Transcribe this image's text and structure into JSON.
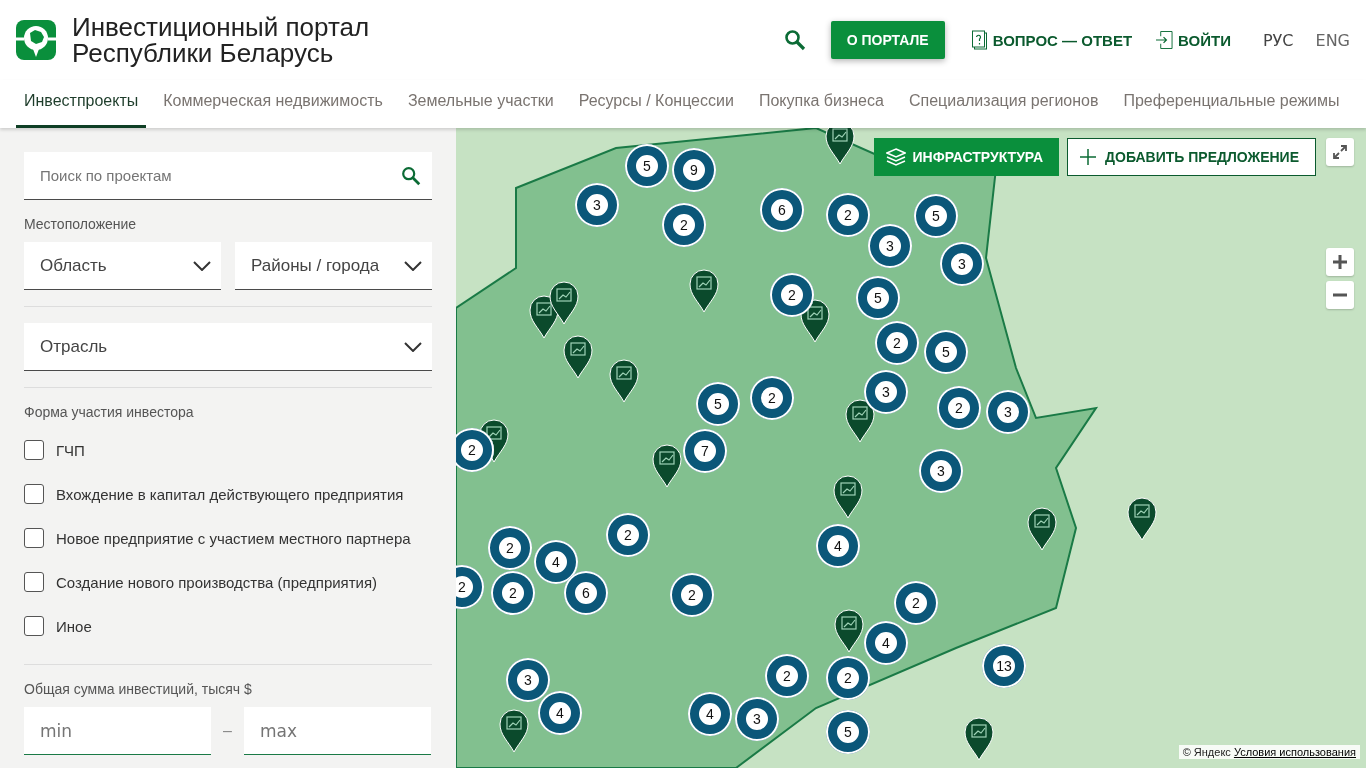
{
  "header": {
    "title_line1": "Инвестиционный портал",
    "title_line2": "Республики Беларусь",
    "about_button": "О ПОРТАЛЕ",
    "faq_link": "ВОПРОС — ОТВЕТ",
    "login_link": "ВОЙТИ",
    "languages": [
      {
        "label": "РУС",
        "selected": true
      },
      {
        "label": "ENG",
        "selected": false
      }
    ]
  },
  "tabs": [
    {
      "label": "Инвестпроекты",
      "selected": true
    },
    {
      "label": "Коммерческая недвижимость",
      "selected": false
    },
    {
      "label": "Земельные участки",
      "selected": false
    },
    {
      "label": "Ресурсы / Концессии",
      "selected": false
    },
    {
      "label": "Покупка бизнеса",
      "selected": false
    },
    {
      "label": "Специализация регионов",
      "selected": false
    },
    {
      "label": "Преференциальные режимы",
      "selected": false
    }
  ],
  "sidebar": {
    "search": {
      "placeholder": "Поиск по проектам"
    },
    "location_label": "Местоположение",
    "region_select": "Область",
    "district_select": "Районы / города",
    "industry_select": "Отрасль",
    "investor_form_label": "Форма участия инвестора",
    "options": [
      {
        "label": "ГЧП",
        "checked": false
      },
      {
        "label": "Вхождение в капитал действующего предприятия",
        "checked": false
      },
      {
        "label": "Новое предприятие с участием местного партнера",
        "checked": false
      },
      {
        "label": "Создание нового производства (предприятия)",
        "checked": false
      },
      {
        "label": "Иное",
        "checked": false
      }
    ],
    "amount_label": "Общая сумма инвестиций, тысяч $",
    "min": {
      "placeholder": "min"
    },
    "dash": "–",
    "max": {
      "placeholder": "max"
    }
  },
  "map": {
    "infrastructure_button": "ИНФРАСТРУКТУРА",
    "add_button": "ДОБАВИТЬ ПРЕДЛОЖЕНИЕ",
    "clusters": [
      "5",
      "9",
      "3",
      "2",
      "6",
      "2",
      "5",
      "3",
      "3",
      "2",
      "5",
      "2",
      "5",
      "5",
      "2",
      "3",
      "2",
      "3",
      "2",
      "7",
      "3",
      "2",
      "2",
      "4",
      "4",
      "2",
      "2",
      "6",
      "2",
      "2",
      "4",
      "3",
      "2",
      "2",
      "13",
      "4",
      "4",
      "3",
      "5"
    ],
    "attribution": "© Яндекс",
    "terms_link": "Условия использования"
  }
}
